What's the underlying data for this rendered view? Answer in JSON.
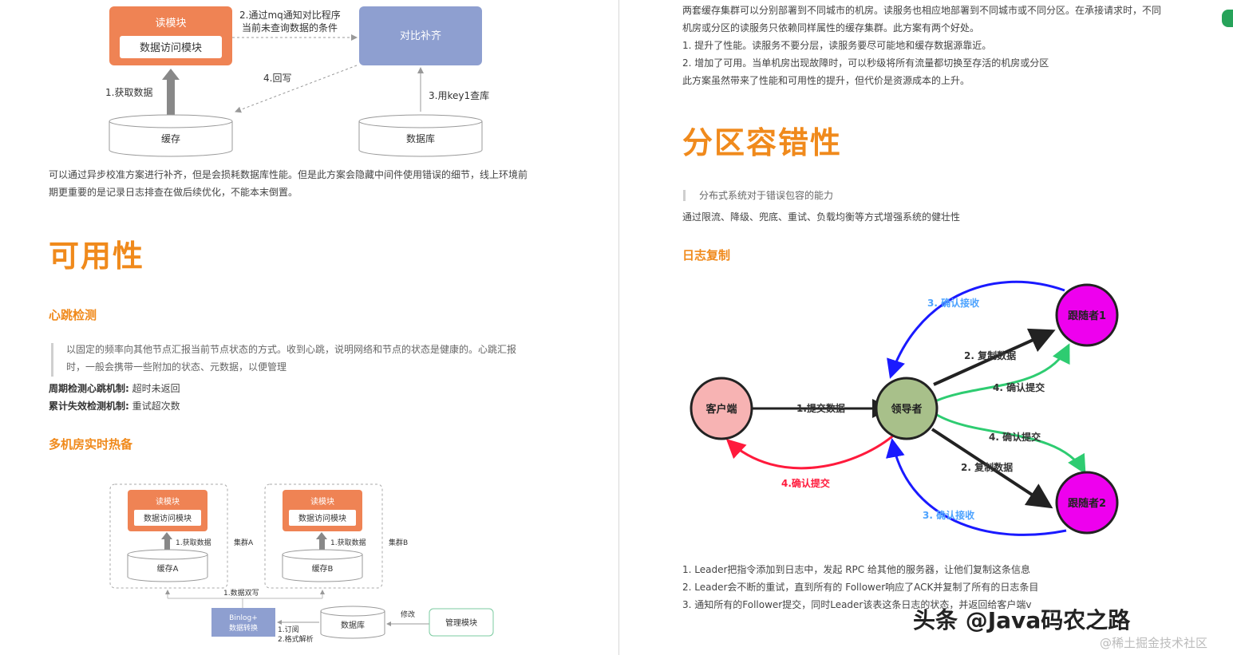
{
  "left": {
    "diagram1": {
      "read_module": "读模块",
      "data_access": "数据访问模块",
      "compare": "对比补齐",
      "step2_line1": "2.通过mq通知对比程序",
      "step2_line2": "当前未查询数据的条件",
      "step4": "4.回写",
      "step1": "1.获取数据",
      "step3": "3.用key1查库",
      "cache": "缓存",
      "db": "数据库"
    },
    "para1_line1": "可以通过异步校准方案进行补齐，但是会损耗数据库性能。但是此方案会隐藏中间件使用错误的细节，线上环境前",
    "para1_line2": "期更重要的是记录日志排查在做后续优化，不能本末倒置。",
    "h1": "可用性",
    "h3_heartbeat": "心跳检测",
    "quote_line1": "以固定的频率向其他节点汇报当前节点状态的方式。收到心跳，说明网络和节点的状态是健康的。心跳汇报",
    "quote_line2": "时，一般会携带一些附加的状态、元数据，以便管理",
    "periodic_label": "周期检测心跳机制:",
    "periodic_value": "超时未返回",
    "cumulative_label": "累计失效检测机制:",
    "cumulative_value": "重试超次数",
    "h3_multi": "多机房实时热备",
    "diagram2": {
      "read_module": "读模块",
      "data_access": "数据访问模块",
      "get_data": "1.获取数据",
      "cluster_a": "集群A",
      "cluster_b": "集群B",
      "cache_a": "缓存A",
      "cache_b": "缓存B",
      "double_write": "1.数据双写",
      "binlog_line1": "Binlog+",
      "binlog_line2": "数据转换",
      "subscribe": "1.订阅",
      "parse": "2.格式解析",
      "db": "数据库",
      "modify": "修改",
      "admin": "管理模块"
    }
  },
  "right": {
    "p1": "两套缓存集群可以分别部署到不同城市的机房。读服务也相应地部署到不同城市或不同分区。在承接请求时，不同",
    "p2": "机房或分区的读服务只依赖同样属性的缓存集群。此方案有两个好处。",
    "p3": "1.  提升了性能。读服务不要分层，读服务要尽可能地和缓存数据源靠近。",
    "p4": "2.  增加了可用。当单机房出现故障时，可以秒级将所有流量都切换至存活的机房或分区",
    "p5": "此方案虽然带来了性能和可用性的提升，但代价是资源成本的上升。",
    "h1": "分区容错性",
    "quote": "分布式系统对于错误包容的能力",
    "p6": "通过限流、降级、兜底、重试、负载均衡等方式增强系统的健壮性",
    "h3": "日志复制",
    "diagram3": {
      "client": "客户端",
      "leader": "领导者",
      "follower1": "跟随者1",
      "follower2": "跟随者2",
      "submit": "1.提交数据",
      "copy1": "2. 复制数据",
      "copy2": "2. 复制数据",
      "ack_recv1": "3. 确认接收",
      "ack_recv2": "3. 确认接收",
      "ack_commit1": "4. 确认提交",
      "ack_commit2": "4. 确认提交",
      "ack_commit_client": "4.确认提交"
    },
    "l1": "1.  Leader把指令添加到日志中，发起 RPC 给其他的服务器，让他们复制这条信息",
    "l2": "2.  Leader会不断的重试，直到所有的 Follower响应了ACK并复制了所有的日志条目",
    "l3": "3.  通知所有的Follower提交，同时Leader该表这条日志的状态，并返回给客户端v"
  },
  "watermark": "头条 @Java码农之路",
  "watermark2": "@稀土掘金技术社区"
}
